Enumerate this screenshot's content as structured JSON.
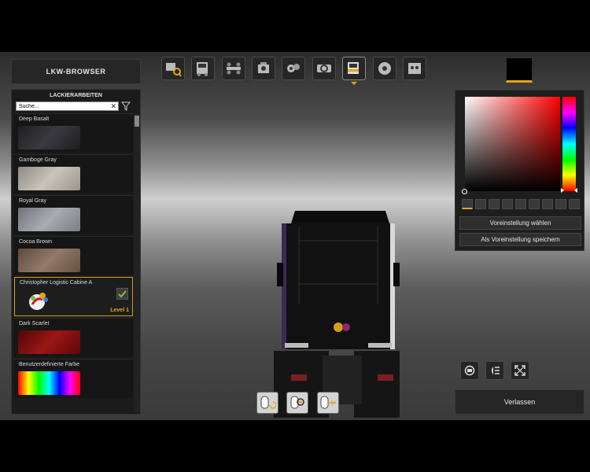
{
  "header": {
    "title": "LKW-BROWSER"
  },
  "paint_panel": {
    "title": "LACKIERARBEITEN",
    "search_value": "Suche...",
    "items": [
      {
        "label": "Deep Basalt",
        "color": "#2a2a2e"
      },
      {
        "label": "Gamboge Gray",
        "color": "#aaa59c"
      },
      {
        "label": "Royal Gray",
        "color": "#8b8e94"
      },
      {
        "label": "Cocoa Brown",
        "color": "#76604f"
      },
      {
        "label": "Christopher Logistic Cabine A",
        "level": "Level 1"
      },
      {
        "label": "Dark Scarlet",
        "color": "#7a0d0d"
      },
      {
        "label": "Benutzerdefinierte Farbe"
      }
    ]
  },
  "color_picker": {
    "preview_color": "#000000",
    "preset_count": 9,
    "choose_preset_label": "Voreinstellung wählen",
    "save_preset_label": "Als Voreinstellung speichern"
  },
  "toolbar": {
    "icons": [
      "truck-search-icon",
      "cabin-icon",
      "chassis-icon",
      "engine-icon",
      "transmission-icon",
      "interior-icon",
      "paint-icon",
      "wheels-icon",
      "accessories-icon"
    ],
    "active_index": 6
  },
  "footer": {
    "leave_label": "Verlassen"
  },
  "colors": {
    "accent": "#e8a31a"
  }
}
